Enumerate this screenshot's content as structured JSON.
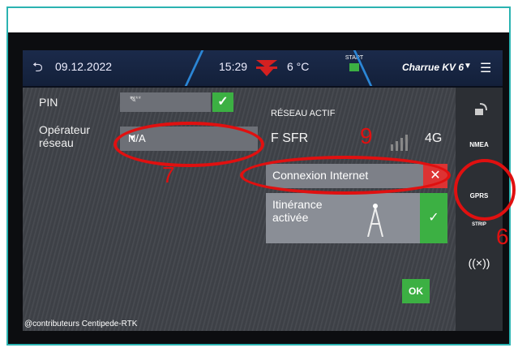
{
  "header": {
    "date": "09.12.2022",
    "time": "15:29",
    "temperature": "6 °C",
    "start_label": "START",
    "profile": "Charrue KV 6"
  },
  "left": {
    "pin_label": "PIN",
    "pin_value": "****",
    "operator_label_line1": "Opérateur",
    "operator_label_line2": "réseau",
    "operator_value": "N/A"
  },
  "right": {
    "active_network_label": "RÉSEAU ACTIF",
    "operator": "F SFR",
    "network_type": "4G",
    "internet_connection": "Connexion Internet",
    "roaming_line1": "Itinérance",
    "roaming_line2": "activée",
    "ok_label": "OK"
  },
  "sidebar": {
    "nmea_label": "NMEA",
    "gprs_label": "GPRS",
    "strip_label": "STRIP"
  },
  "annotations": {
    "a7": "7",
    "a9": "9",
    "a6": "6"
  },
  "credit": "@contributeurs Centipede-RTK",
  "colors": {
    "accent_green": "#3cb043",
    "annotation_red": "#e01010",
    "frame_teal": "#2bb3b1"
  }
}
